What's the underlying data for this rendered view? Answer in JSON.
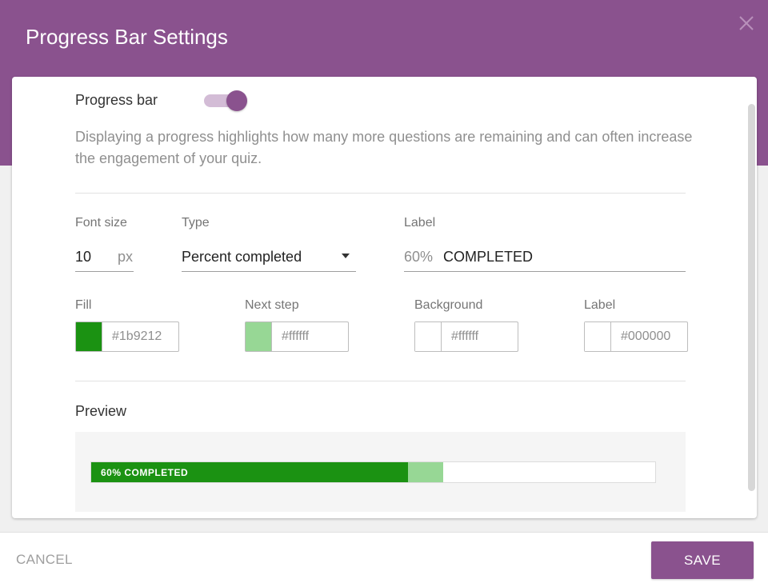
{
  "dialog": {
    "title": "Progress Bar Settings",
    "close_icon": "close-icon",
    "header_color": "#8a528e"
  },
  "toggle": {
    "label": "Progress bar",
    "on": true
  },
  "description": "Displaying a progress highlights how many more questions are remaining and can often increase the engagement of your quiz.",
  "font_size": {
    "label": "Font size",
    "value": "10",
    "unit": "px"
  },
  "type": {
    "label": "Type",
    "value": "Percent completed",
    "icon": "dropdown-arrow-icon"
  },
  "label_field": {
    "label": "Label",
    "prefix": "60%",
    "value": "COMPLETED"
  },
  "colors": [
    {
      "label": "Fill",
      "value": "#1b9212",
      "swatch": "#1b9212"
    },
    {
      "label": "Next step",
      "value": "#ffffff",
      "swatch": "#97d795"
    },
    {
      "label": "Background",
      "value": "#ffffff",
      "swatch": "#ffffff"
    },
    {
      "label": "Label",
      "value": "#000000",
      "swatch": "#ffffff"
    }
  ],
  "preview": {
    "label": "Preview",
    "bar_text": "60% COMPLETED",
    "progress_fraction": 0.5615,
    "next_step_fraction": 0.6238,
    "fill_color": "#1b9212",
    "next_color": "#97d795"
  },
  "footer": {
    "cancel_label": "CANCEL",
    "save_label": "SAVE"
  }
}
